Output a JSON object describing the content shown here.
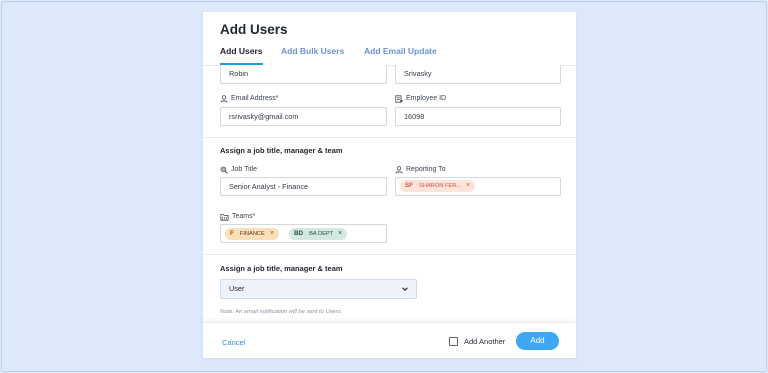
{
  "modal": {
    "title": "Add Users",
    "tabs": [
      {
        "label": "Add Users",
        "active": true
      },
      {
        "label": "Add Bulk Users",
        "active": false
      },
      {
        "label": "Add Email Update",
        "active": false
      }
    ]
  },
  "form": {
    "first_name": "Robin",
    "last_name": "Srivasky",
    "email_label": "Email Address*",
    "email_value": "rsrivasky@gmail.com",
    "employee_id_label": "Employee ID",
    "employee_id_value": "16098",
    "section1_title": "Assign a job title, manager & team",
    "job_title_label": "Job Title",
    "job_title_value": "Senior Analyst - Finance",
    "reporting_to_label": "Reporting To",
    "reporting_chip": {
      "initials": "SF",
      "name": "SHARON FER...",
      "remove": "×"
    },
    "teams_label": "Teams*",
    "team_chips": [
      {
        "initials": "F",
        "name": "FINANCE",
        "remove": "×"
      },
      {
        "initials": "BD",
        "name": "BA DEPT",
        "remove": "×"
      }
    ],
    "section2_title": "Assign a job title, manager & team",
    "role_value": "User",
    "note": "Note: An email notification will be sent to Users."
  },
  "footer": {
    "cancel_label": "Cancel",
    "add_another_label": "Add Another",
    "add_label": "Add"
  },
  "colors": {
    "background": "#dde9fb",
    "accent": "#3fa6f3",
    "tab_inactive": "#6c93c9",
    "tab_underline": "#1a9fd6"
  }
}
